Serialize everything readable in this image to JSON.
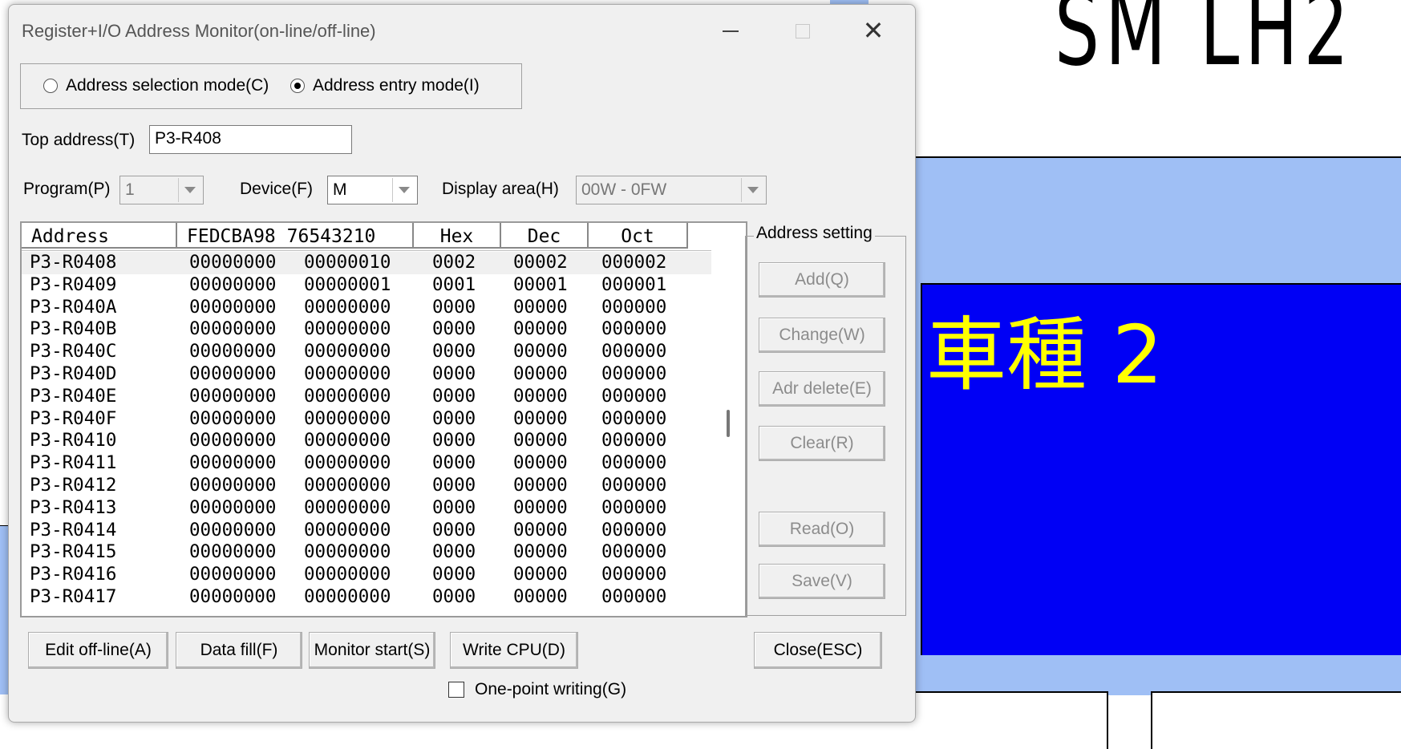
{
  "background": {
    "title_text": "SM LH2",
    "car_label": "車種 2",
    "colors": {
      "light_blue": "#9fbff5",
      "blue": "#0000f5",
      "yellow": "#ffff00"
    }
  },
  "dialog": {
    "title": "Register+I/O Address Monitor(on-line/off-line)",
    "mode": {
      "selection_label": "Address selection mode(C)",
      "entry_label": "Address entry mode(I)",
      "selected": "entry"
    },
    "top_address": {
      "label": "Top address(T)",
      "value": "P3-R408"
    },
    "program": {
      "label": "Program(P)",
      "value": "1"
    },
    "device": {
      "label": "Device(F)",
      "value": "M"
    },
    "display_area": {
      "label": "Display area(H)",
      "value": "00W - 0FW"
    },
    "table": {
      "headers": {
        "address": "Address",
        "binary": "FEDCBA98 76543210",
        "hex": "Hex",
        "dec": "Dec",
        "oct": "Oct"
      },
      "rows": [
        {
          "address": "P3-R0408",
          "hi": "00000000",
          "lo": "00000010",
          "hex": "0002",
          "dec": "00002",
          "oct": "000002"
        },
        {
          "address": "P3-R0409",
          "hi": "00000000",
          "lo": "00000001",
          "hex": "0001",
          "dec": "00001",
          "oct": "000001"
        },
        {
          "address": "P3-R040A",
          "hi": "00000000",
          "lo": "00000000",
          "hex": "0000",
          "dec": "00000",
          "oct": "000000"
        },
        {
          "address": "P3-R040B",
          "hi": "00000000",
          "lo": "00000000",
          "hex": "0000",
          "dec": "00000",
          "oct": "000000"
        },
        {
          "address": "P3-R040C",
          "hi": "00000000",
          "lo": "00000000",
          "hex": "0000",
          "dec": "00000",
          "oct": "000000"
        },
        {
          "address": "P3-R040D",
          "hi": "00000000",
          "lo": "00000000",
          "hex": "0000",
          "dec": "00000",
          "oct": "000000"
        },
        {
          "address": "P3-R040E",
          "hi": "00000000",
          "lo": "00000000",
          "hex": "0000",
          "dec": "00000",
          "oct": "000000"
        },
        {
          "address": "P3-R040F",
          "hi": "00000000",
          "lo": "00000000",
          "hex": "0000",
          "dec": "00000",
          "oct": "000000"
        },
        {
          "address": "P3-R0410",
          "hi": "00000000",
          "lo": "00000000",
          "hex": "0000",
          "dec": "00000",
          "oct": "000000"
        },
        {
          "address": "P3-R0411",
          "hi": "00000000",
          "lo": "00000000",
          "hex": "0000",
          "dec": "00000",
          "oct": "000000"
        },
        {
          "address": "P3-R0412",
          "hi": "00000000",
          "lo": "00000000",
          "hex": "0000",
          "dec": "00000",
          "oct": "000000"
        },
        {
          "address": "P3-R0413",
          "hi": "00000000",
          "lo": "00000000",
          "hex": "0000",
          "dec": "00000",
          "oct": "000000"
        },
        {
          "address": "P3-R0414",
          "hi": "00000000",
          "lo": "00000000",
          "hex": "0000",
          "dec": "00000",
          "oct": "000000"
        },
        {
          "address": "P3-R0415",
          "hi": "00000000",
          "lo": "00000000",
          "hex": "0000",
          "dec": "00000",
          "oct": "000000"
        },
        {
          "address": "P3-R0416",
          "hi": "00000000",
          "lo": "00000000",
          "hex": "0000",
          "dec": "00000",
          "oct": "000000"
        },
        {
          "address": "P3-R0417",
          "hi": "00000000",
          "lo": "00000000",
          "hex": "0000",
          "dec": "00000",
          "oct": "000000"
        }
      ]
    },
    "address_setting": {
      "legend": "Address setting",
      "add": "Add(Q)",
      "change": "Change(W)",
      "delete": "Adr delete(E)",
      "clear": "Clear(R)",
      "read": "Read(O)",
      "save": "Save(V)"
    },
    "buttons": {
      "edit_offline": "Edit off-line(A)",
      "data_fill": "Data fill(F)",
      "monitor_start": "Monitor start(S)",
      "write_cpu": "Write CPU(D)",
      "close": "Close(ESC)"
    },
    "one_point_writing": {
      "label": "One-point writing(G)",
      "checked": false
    }
  }
}
